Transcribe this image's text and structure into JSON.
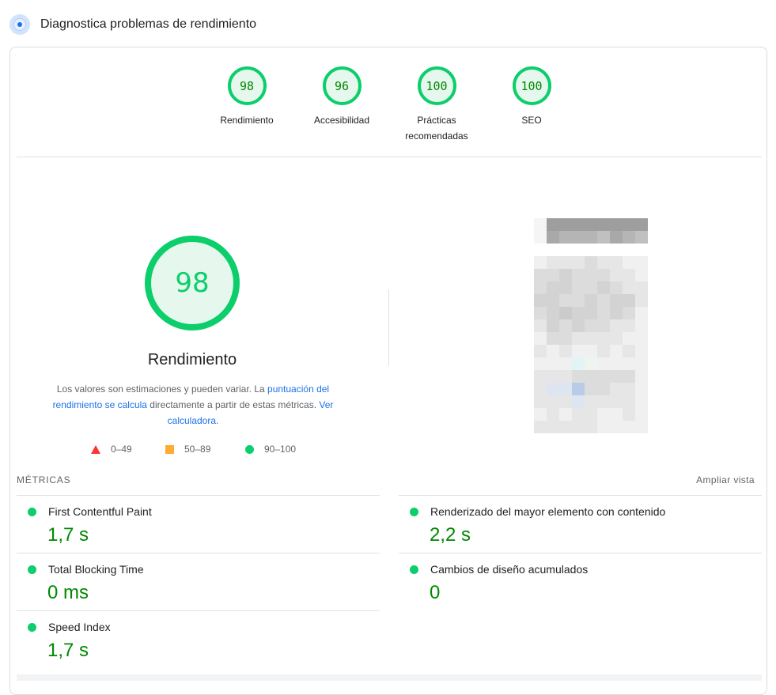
{
  "header": {
    "title": "Diagnostica problemas de rendimiento",
    "icon": "lighthouse-icon"
  },
  "categories": [
    {
      "score": "98",
      "label": "Rendimiento"
    },
    {
      "score": "96",
      "label": "Accesibilidad"
    },
    {
      "score": "100",
      "label": "Prácticas recomendadas"
    },
    {
      "score": "100",
      "label": "SEO"
    }
  ],
  "performance": {
    "score": "98",
    "title": "Rendimiento",
    "description_pre": "Los valores son estimaciones y pueden variar. La ",
    "description_link1": "puntuación del rendimiento se calcula",
    "description_mid": " directamente a partir de estas métricas. ",
    "description_link2": "Ver calculadora",
    "description_post": "."
  },
  "legend": [
    {
      "range": "0–49",
      "shape": "triangle",
      "color": "#ff3333"
    },
    {
      "range": "50–89",
      "shape": "square",
      "color": "#ffaa33"
    },
    {
      "range": "90–100",
      "shape": "circle",
      "color": "#0cce6b"
    }
  ],
  "metrics": {
    "header": "MÉTRICAS",
    "expand_label": "Ampliar vista",
    "items": [
      {
        "name": "First Contentful Paint",
        "value": "1,7 s"
      },
      {
        "name": "Renderizado del mayor elemento con contenido",
        "value": "2,2 s"
      },
      {
        "name": "Total Blocking Time",
        "value": "0 ms"
      },
      {
        "name": "Cambios de diseño acumulados",
        "value": "0"
      },
      {
        "name": "Speed Index",
        "value": "1,7 s"
      }
    ]
  },
  "colors": {
    "pass": "#0cce6b",
    "pass_text": "#008800",
    "link": "#1a73e8"
  }
}
